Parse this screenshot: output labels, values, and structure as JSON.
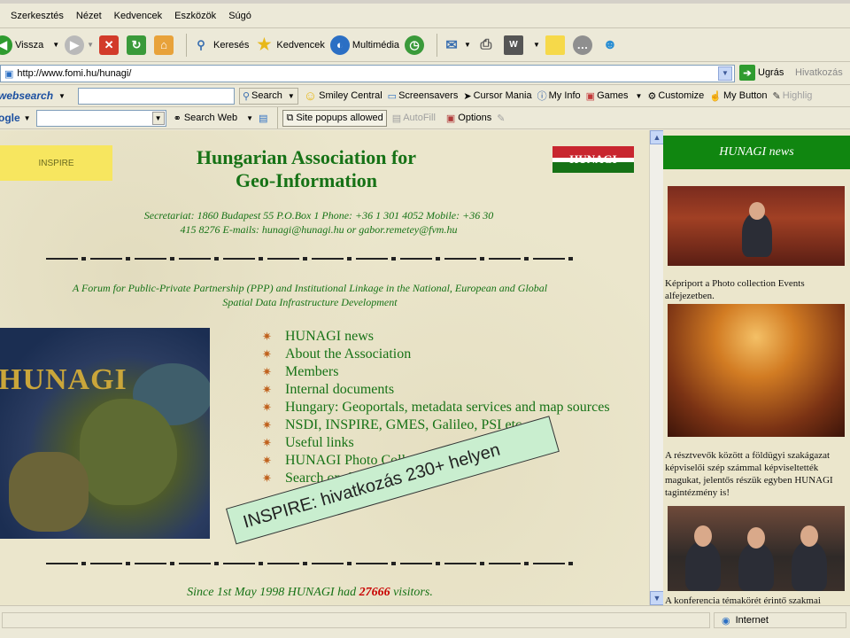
{
  "menu": [
    "Szerkesztés",
    "Nézet",
    "Kedvencek",
    "Eszközök",
    "Súgó"
  ],
  "toolbar": {
    "back": "Vissza",
    "search": "Keresés",
    "favorites": "Kedvencek",
    "multimedia": "Multimédia"
  },
  "address": {
    "url": "http://www.fomi.hu/hunagi/",
    "go": "Ugrás",
    "links": "Hivatkozás"
  },
  "websearch_bar": {
    "brand": "websearch",
    "search_btn": "Search",
    "smiley": "Smiley Central",
    "screensavers": "Screensavers",
    "cursor": "Cursor Mania",
    "myinfo": "My Info",
    "games": "Games",
    "customize": "Customize",
    "mybutton": "My Button",
    "highlight": "Highlig"
  },
  "google_bar": {
    "brand": "ogle",
    "search_web": "Search Web",
    "popups": "Site popups allowed",
    "autofill": "AutoFill",
    "options": "Options"
  },
  "page": {
    "inspire_tag": "INSPIRE",
    "title_line1": "Hungarian Association for",
    "title_line2": "Geo-Information",
    "logo": "HUNAGI",
    "secretariat_line1": "Secretariat: 1860 Budapest 55 P.O.Box 1 Phone: +36 1 301 4052 Mobile: +36 30",
    "secretariat_line2": "415 8276 E-mails: hunagi@hunagi.hu  or gabor.remetey@fvm.hu",
    "forum_line1": "A Forum for Public-Private Partnership (PPP) and Institutional Linkage in the National, European and Global",
    "forum_line2": "Spatial Data Infrastructure Development",
    "map_label": "HUNAGI",
    "nav": [
      "HUNAGI news",
      "About the Association",
      "Members",
      "Internal documents",
      "Hungary: Geoportals, metadata services and map sources",
      "NSDI, INSPIRE, GMES, Galileo, PSI etc.",
      "Useful links",
      "HUNAGI Photo Collection",
      "Search on this site"
    ],
    "visitors_prefix": "Since 1st May 1998 HUNAGI had ",
    "visitors_count": "27666",
    "visitors_suffix": " visitors."
  },
  "sidebar": {
    "header": "HUNAGI news",
    "caption1": "Képriport a Photo collection Events alfejezetben.",
    "caption2": "A résztvevők között a földügyi szakágazat képviselői szép számmal képviseltették magukat, jelentős részük egyben HUNAGI tagintézmény is!",
    "caption3": "A konferencia témakörét érintő szakmai"
  },
  "status": {
    "zone": "Internet"
  },
  "callout": "INSPIRE:  hivatkozás 230+ helyen"
}
